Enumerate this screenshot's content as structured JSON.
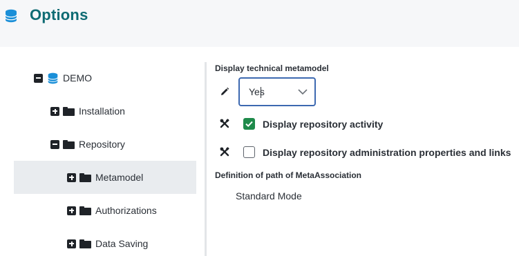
{
  "header": {
    "title": "Options",
    "icon": "database-icon",
    "title_color": "#0e6b73"
  },
  "tree": {
    "root": {
      "label": "DEMO",
      "expanded": true,
      "icon": "database-icon"
    },
    "items": [
      {
        "label": "Installation",
        "expanded": false,
        "level": 1
      },
      {
        "label": "Repository",
        "expanded": true,
        "level": 1
      },
      {
        "label": "Metamodel",
        "expanded": false,
        "level": 2,
        "selected": true
      },
      {
        "label": "Authorizations",
        "expanded": false,
        "level": 2
      },
      {
        "label": "Data Saving",
        "expanded": false,
        "level": 2
      }
    ]
  },
  "content": {
    "technical_metamodel": {
      "label": "Display technical metamodel",
      "icon": "pencil-icon",
      "value": "Yes"
    },
    "repository_activity": {
      "label": "Display repository activity",
      "icon": "tools-icon",
      "checked": true
    },
    "repository_admin": {
      "label": "Display repository administration properties and links",
      "icon": "tools-icon",
      "checked": false
    },
    "meta_association": {
      "label": "Definition of path of MetaAssociation",
      "value": "Standard Mode"
    }
  },
  "colors": {
    "accent": "#0e6b73",
    "checkbox": "#1e8a4a",
    "focus_border": "#3c68b0",
    "db_icon": "#1a8fd8"
  }
}
